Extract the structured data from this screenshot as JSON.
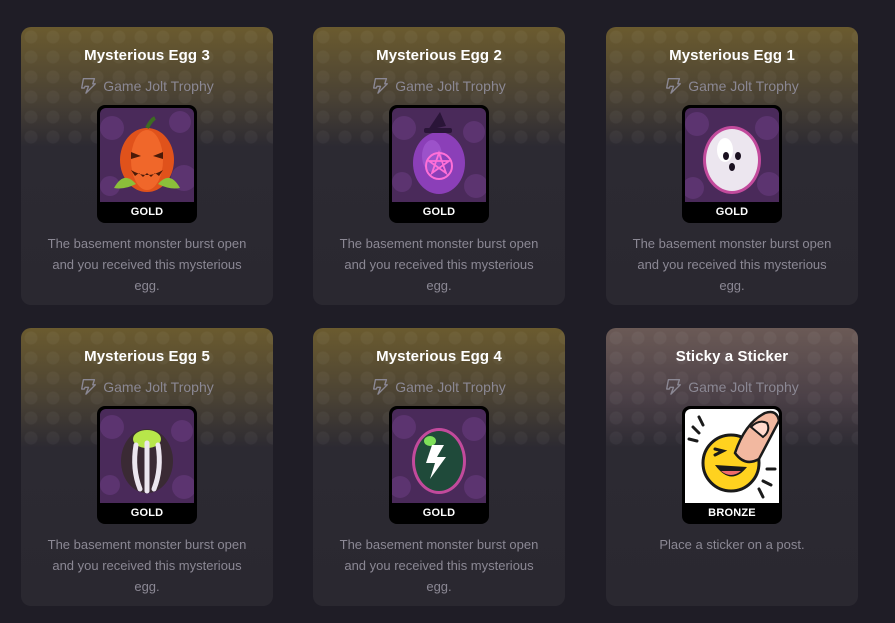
{
  "trophies": [
    {
      "title": "Mysterious Egg 3",
      "source": "Game Jolt Trophy",
      "tier": "GOLD",
      "description": "The basement monster burst open and you received this mysterious egg.",
      "icon": "pumpkin-egg-icon"
    },
    {
      "title": "Mysterious Egg 2",
      "source": "Game Jolt Trophy",
      "tier": "GOLD",
      "description": "The basement monster burst open and you received this mysterious egg.",
      "icon": "witch-egg-icon"
    },
    {
      "title": "Mysterious Egg 1",
      "source": "Game Jolt Trophy",
      "tier": "GOLD",
      "description": "The basement monster burst open and you received this mysterious egg.",
      "icon": "ghost-egg-icon"
    },
    {
      "title": "Mysterious Egg 5",
      "source": "Game Jolt Trophy",
      "tier": "GOLD",
      "description": "The basement monster burst open and you received this mysterious egg.",
      "icon": "striped-egg-icon"
    },
    {
      "title": "Mysterious Egg 4",
      "source": "Game Jolt Trophy",
      "tier": "GOLD",
      "description": "The basement monster burst open and you received this mysterious egg.",
      "icon": "lightning-egg-icon"
    },
    {
      "title": "Sticky a Sticker",
      "source": "Game Jolt Trophy",
      "tier": "BRONZE",
      "description": "Place a sticker on a post.",
      "icon": "sticker-face-icon"
    }
  ],
  "colors": {
    "background": "#1f1d26",
    "gold_header": "#6b5b2f",
    "bronze_header": "#6b5a56",
    "card": "#2a2830",
    "muted_text": "#8b8894"
  }
}
